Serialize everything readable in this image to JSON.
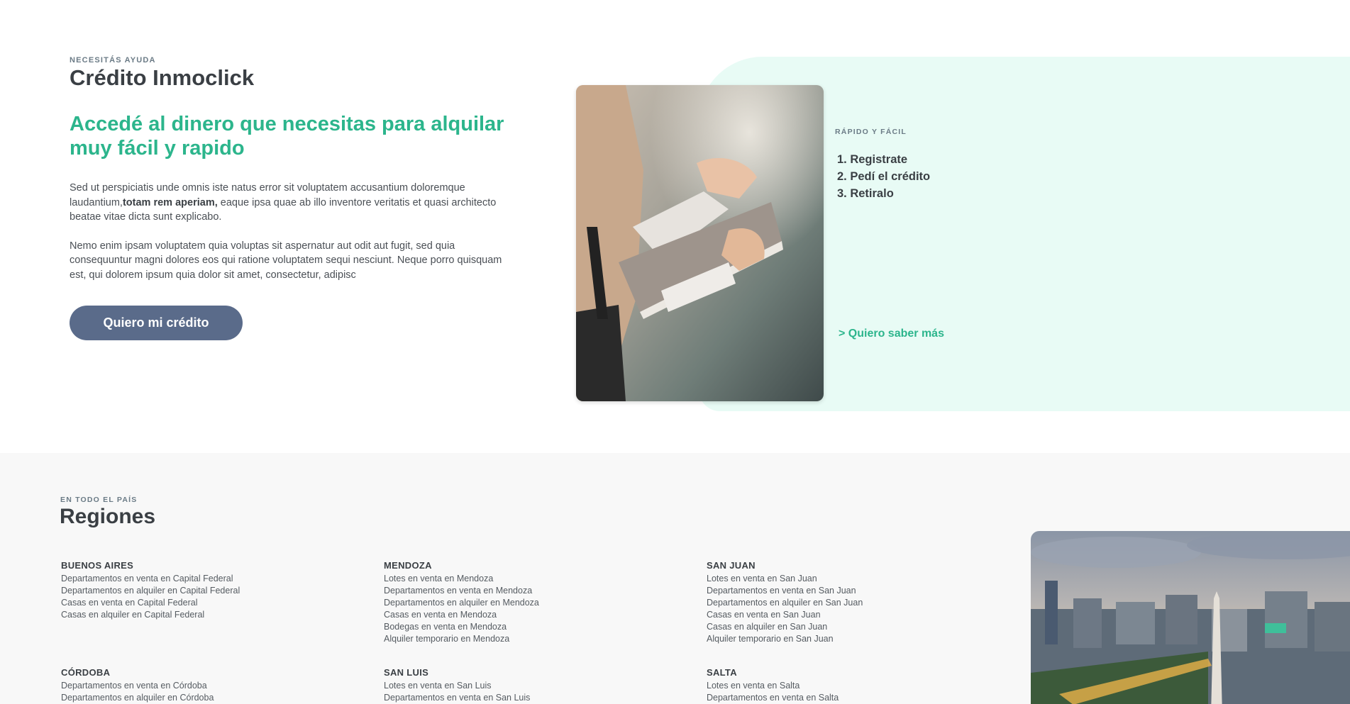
{
  "credit": {
    "eyebrow": "NECESITÁS AYUDA",
    "title": "Crédito Inmoclick",
    "headline": "Accedé al dinero que necesitas para alquilar muy fácil y rapido",
    "p1_before": "Sed ut perspiciatis unde omnis iste natus error sit voluptatem accusantium doloremque laudantium,",
    "p1_bold": "totam rem aperiam,",
    "p1_after": " eaque ipsa quae ab illo inventore veritatis et quasi architecto beatae vitae dicta sunt explicabo.",
    "p2": "Nemo enim ipsam voluptatem quia voluptas sit aspernatur aut odit aut fugit, sed quia consequuntur magni dolores eos qui ratione voluptatem sequi nesciunt. Neque porro quisquam est, qui dolorem ipsum quia dolor sit amet, consectetur, adipisc",
    "button": "Quiero mi crédito",
    "steps_eyebrow": "RÁPIDO Y FÁCIL",
    "steps": [
      "1. Registrate",
      "2. Pedí el crédito",
      "3. Retiralo"
    ],
    "more_link": "> Quiero saber más"
  },
  "regions": {
    "eyebrow": "EN TODO EL PAÍS",
    "title": "Regiones",
    "list": [
      {
        "name": "BUENOS AIRES",
        "links": [
          "Departamentos en venta en Capital Federal",
          "Departamentos en alquiler en Capital Federal",
          "Casas en venta en Capital Federal",
          "Casas en alquiler en Capital Federal"
        ]
      },
      {
        "name": "MENDOZA",
        "links": [
          "Lotes en venta en Mendoza",
          "Departamentos en venta en Mendoza",
          "Departamentos en alquiler en Mendoza",
          "Casas en venta en Mendoza",
          "Bodegas en venta en Mendoza",
          "Alquiler temporario en Mendoza"
        ]
      },
      {
        "name": "SAN JUAN",
        "links": [
          "Lotes en venta en San Juan",
          "Departamentos en venta en San Juan",
          "Departamentos en alquiler en San Juan",
          "Casas en venta en San Juan",
          "Casas en alquiler en San Juan",
          "Alquiler temporario en San Juan"
        ]
      },
      {
        "name": "CÓRDOBA",
        "links": [
          "Departamentos en venta en Córdoba",
          "Departamentos en alquiler en Córdoba"
        ]
      },
      {
        "name": "SAN LUIS",
        "links": [
          "Lotes en venta en San Luis",
          "Departamentos en venta en San Luis"
        ]
      },
      {
        "name": "SALTA",
        "links": [
          "Lotes en venta en Salta",
          "Departamentos en venta en Salta"
        ]
      }
    ]
  },
  "colors": {
    "accent": "#2cb58c",
    "button": "#5a6b8a",
    "mint": "#e8fbf5",
    "text": "#3a3f44"
  }
}
